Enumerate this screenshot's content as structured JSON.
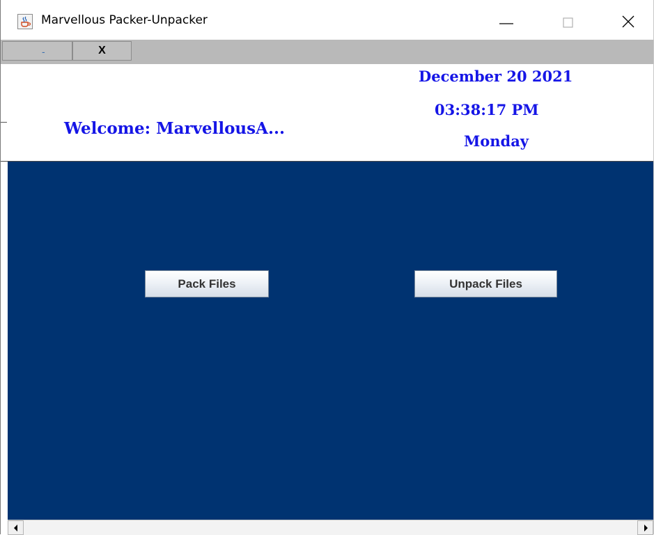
{
  "window": {
    "title": "Marvellous Packer-Unpacker",
    "icon": "java-cup-icon"
  },
  "strip": {
    "minimize_label": "-",
    "close_label": "X"
  },
  "header": {
    "welcome": "Welcome: MarvellousA...",
    "date": "December 20 2021",
    "time": "03:38:17 PM",
    "day": "Monday"
  },
  "main": {
    "pack_label": "Pack Files",
    "unpack_label": "Unpack Files"
  },
  "colors": {
    "panel_background": "#003371",
    "header_text": "#1515e6",
    "strip_background": "#b9b9b9"
  }
}
